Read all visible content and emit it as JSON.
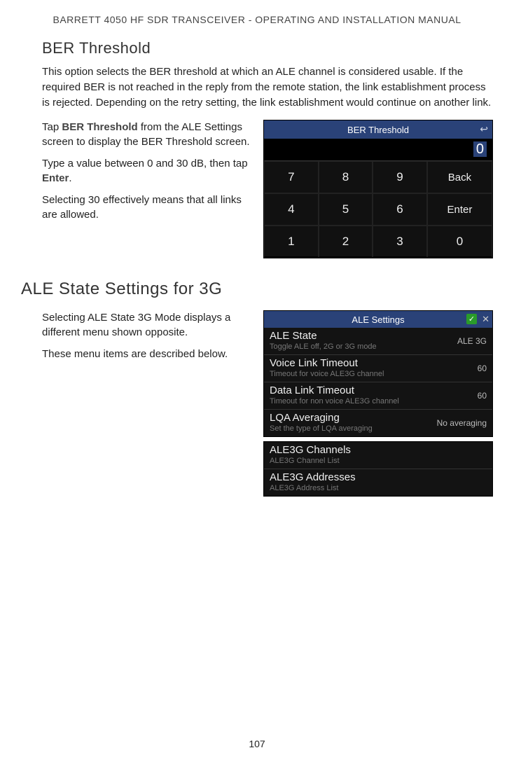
{
  "header": "BARRETT 4050 HF SDR TRANSCEIVER - OPERATING AND INSTALLATION MANUAL",
  "section1": {
    "title": "BER Threshold",
    "intro": "This option selects the BER threshold at which an ALE channel is considered usable. If the required BER is not reached in the reply from the remote station, the link establishment process is rejected. Depending on the retry setting, the link establishment would continue on another link.",
    "p1a": "Tap ",
    "p1b": "BER Threshold",
    "p1c": " from the ALE Settings screen to display the BER Threshold screen.",
    "p2a": "Type a value between 0 and 30 dB, then tap ",
    "p2b": "Enter",
    "p2c": ".",
    "p3": "Selecting 30 effectively means that all links are allowed."
  },
  "keypad": {
    "title": "BER Threshold",
    "display": "0",
    "row1": [
      "7",
      "8",
      "9",
      "Back"
    ],
    "row2": [
      "4",
      "5",
      "6",
      "Enter"
    ],
    "row3": [
      "1",
      "2",
      "3",
      "0"
    ]
  },
  "section2": {
    "title": "ALE State Settings for 3G",
    "p1": "Selecting ALE State 3G Mode displays a different menu shown opposite.",
    "p2": "These menu items are described below."
  },
  "ale": {
    "title": "ALE Settings",
    "rows1": [
      {
        "label": "ALE State",
        "sub": "Toggle ALE off, 2G or 3G mode",
        "val": "ALE 3G"
      },
      {
        "label": "Voice Link Timeout",
        "sub": "Timeout for voice ALE3G channel",
        "val": "60"
      },
      {
        "label": "Data Link Timeout",
        "sub": "Timeout for non voice ALE3G channel",
        "val": "60"
      },
      {
        "label": "LQA Averaging",
        "sub": "Set the type of LQA averaging",
        "val": "No averaging"
      }
    ],
    "rows2": [
      {
        "label": "ALE3G Channels",
        "sub": "ALE3G Channel List",
        "val": ""
      },
      {
        "label": "ALE3G Addresses",
        "sub": "ALE3G Address List",
        "val": ""
      }
    ]
  },
  "page": "107"
}
